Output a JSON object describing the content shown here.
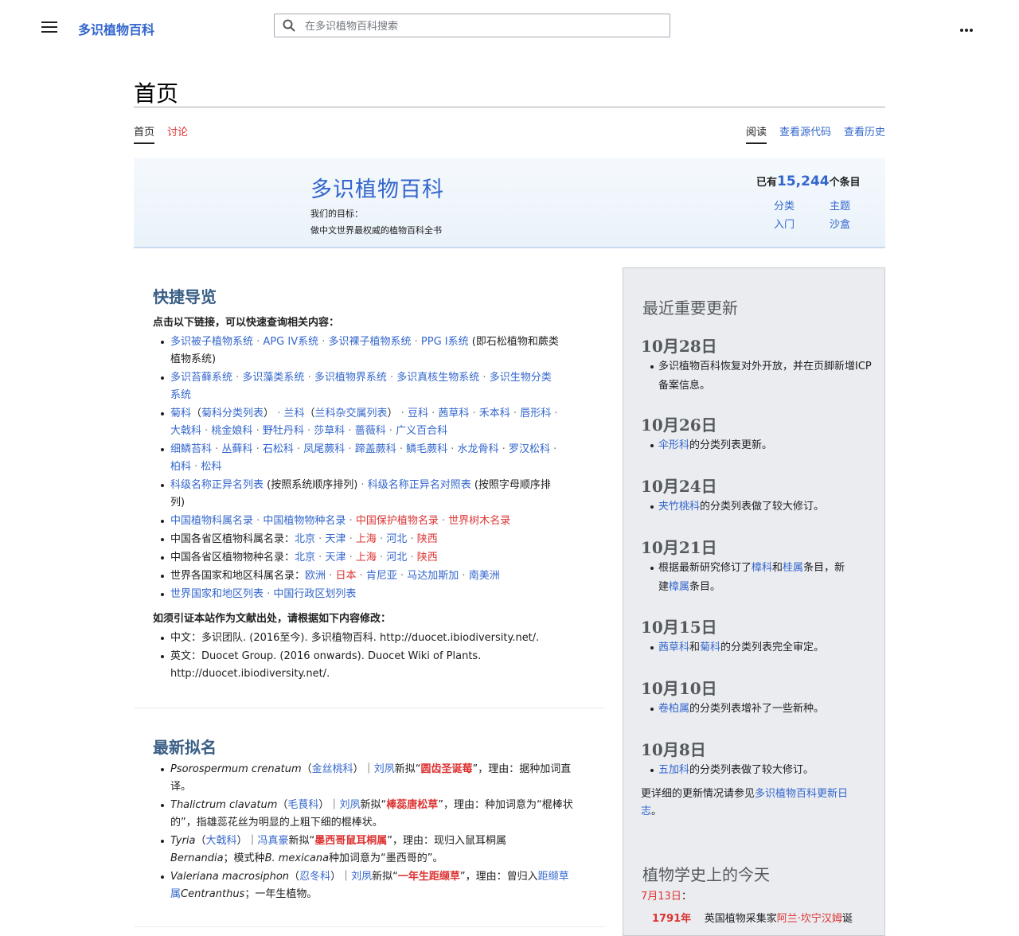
{
  "header": {
    "site_name": "多识植物百科",
    "search_placeholder": "在多识植物百科搜索"
  },
  "page": {
    "title": "首页",
    "tabs_left": [
      "首页",
      "讨论"
    ],
    "tabs_right": [
      "阅读",
      "查看源代码",
      "查看历史"
    ]
  },
  "banner": {
    "title": "多识植物百科",
    "goal_label": "我们的目标：",
    "goal_text": "做中文世界最权威的植物百科全书",
    "count_prefix": "已有",
    "count_value": "15,244",
    "count_suffix": "个条目",
    "links": [
      "分类",
      "主题",
      "入门",
      "沙盒"
    ]
  },
  "quick_nav": {
    "title": "快捷导览",
    "intro": "点击以下链接，可以快速查询相关内容：",
    "line1": {
      "l1": "多识被子植物系统",
      "l2": "APG IV系统",
      "l3": "多识裸子植物系统",
      "l4": "PPG I系统",
      "t1": " (即石松植物和蕨类",
      "t2": "植物系统)"
    },
    "line2": {
      "l1": "多识苔藓系统",
      "l2": "多识藻类系统",
      "l3": "多识植物界系统",
      "l4": "多识真核生物系统",
      "l5": "多识生物分类",
      "l6": "系统"
    },
    "line3": {
      "a": "菊科",
      "b": "菊科分类列表",
      "c": "兰科",
      "d": "兰科杂交属列表",
      "e": "豆科",
      "f": "茜草科",
      "g": "禾本科",
      "h": "唇形科",
      "i": "大戟科",
      "j": "桃金娘科",
      "k": "野牡丹科",
      "l": "莎草科",
      "m": "蔷薇科",
      "n": "广义百合科"
    },
    "line4": {
      "a": "细鳞苔科",
      "b": "丛藓科",
      "c": "石松科",
      "d": "凤尾蕨科",
      "e": "蹄盖蕨科",
      "f": "鳞毛蕨科",
      "g": "水龙骨科",
      "h": "罗汉松科",
      "i": "柏科",
      "j": "松科"
    },
    "line5": {
      "a": "科级名称正异名列表",
      "b": " (按照系统顺序排列)",
      "c": "科级名称正异名对照表",
      "d": " (按照字母顺序排",
      "e": "列)"
    },
    "line6": {
      "a": "中国植物科属名录",
      "b": "中国植物物种名录",
      "c": "中国保护植物名录",
      "d": "世界树木名录"
    },
    "line7": {
      "label": "中国各省区植物科属名录：",
      "a": "北京",
      "b": "天津",
      "c": "上海",
      "d": "河北",
      "e": "陕西"
    },
    "line8": {
      "label": "中国各省区植物物种名录：",
      "a": "北京",
      "b": "天津",
      "c": "上海",
      "d": "河北",
      "e": "陕西"
    },
    "line9": {
      "label": "世界各国家和地区科属名录：",
      "a": "欧洲",
      "b": "日本",
      "c": "肯尼亚",
      "d": "马达加斯加",
      "e": "南美洲"
    },
    "line10": {
      "a": "世界国家和地区列表",
      "b": "中国行政区划列表"
    },
    "cite_head": "如须引证本站作为文献出处，请根据如下内容修改：",
    "cite_cn": "中文：多识团队. (2016至今). 多识植物百科. http://duocet.ibiodiversity.net/.",
    "cite_en1": "英文：Duocet Group. (2016 onwards). Duocet Wiki of Plants.",
    "cite_en2": "http://duocet.ibiodiversity.net/."
  },
  "new_names": {
    "title": "最新拟名",
    "n1": {
      "sp": "Psorospermum crenatum",
      "fam": "金丝桃科",
      "who": "刘夙",
      "name": "圆齿圣诞莓",
      "rest": "，理由：据种加词直",
      "rest2": "译。"
    },
    "n2": {
      "sp": "Thalictrum clavatum",
      "fam": "毛茛科",
      "who": "刘夙",
      "name": "棒蕊唐松草",
      "rest": "，理由：种加词意为“棍棒状",
      "rest2": "的”，指雄蕊花丝为明显的上粗下细的棍棒状。"
    },
    "n3": {
      "sp": "Tyria",
      "fam": "大戟科",
      "who": "冯真豪",
      "name": "墨西哥鼠耳桐属",
      "rest": "，理由：现归入鼠耳桐属",
      "rest2a": "Bernandia",
      "rest2b": "；模式种",
      "rest2c": "B. mexicana",
      "rest2d": "种加词意为“墨西哥的”。"
    },
    "n4": {
      "sp": "Valeriana macrosiphon",
      "fam": "忍冬科",
      "who": "刘夙",
      "name": "一年生距缬草",
      "rest": "，理由：曾归入",
      "rest_link": "距缬草",
      "rest2a": "属",
      "rest2b": "Centranthus",
      "rest2c": "；一年生植物。"
    }
  },
  "updates": {
    "title": "最近重要更新",
    "d1": "10月28日",
    "d1_text": "多识植物百科恢复对外开放，并在页脚新增ICP备案信息。",
    "d2": "10月26日",
    "d2_link": "伞形科",
    "d2_text": "的分类列表更新。",
    "d3": "10月24日",
    "d3_link": "夹竹桃科",
    "d3_text": "的分类列表做了较大修订。",
    "d4": "10月21日",
    "d4_a": "根据最新研究修订了",
    "d4_l1": "樟科",
    "d4_b": "和",
    "d4_l2": "桂属",
    "d4_c": "条目，新",
    "d4_d": "建",
    "d4_l3": "樟属",
    "d4_e": "条目。",
    "d5": "10月15日",
    "d5_l1": "茜草科",
    "d5_b": "和",
    "d5_l2": "菊科",
    "d5_text": "的分类列表完全审定。",
    "d6": "10月10日",
    "d6_link": "卷柏属",
    "d6_text": "的分类列表增补了一些新种。",
    "d7": "10月8日",
    "d7_link": "五加科",
    "d7_text": "的分类列表做了较大修订。",
    "more_a": "更详细的更新情况请参见",
    "more_link1": "多识植物百科更新日",
    "more_link2": "志",
    "more_b": "。"
  },
  "today": {
    "title": "植物学史上的今天",
    "date": "7月13日",
    "colon": "：",
    "year": "1791年",
    "text_a": "英国植物采集家",
    "person": "阿兰·坎宁汉姆",
    "text_b": "诞"
  }
}
